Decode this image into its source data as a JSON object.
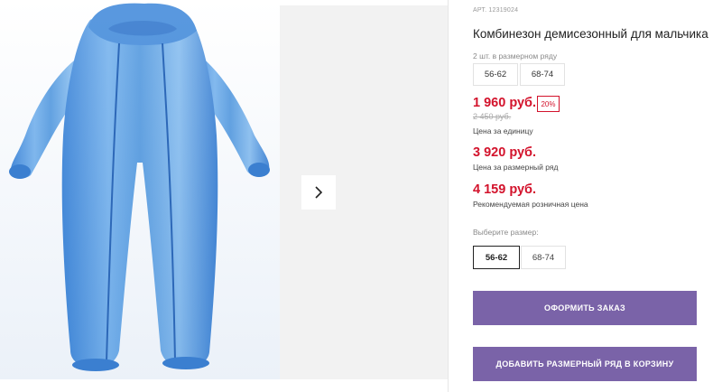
{
  "product": {
    "article": "АРТ. 12319024",
    "title": "Комбинезон демисезонный для мальчика",
    "pack_count": "2 шт. в размерном ряду",
    "pack_sizes": [
      "56-62",
      "68-74"
    ]
  },
  "prices": {
    "unit_price": "1 960 руб.",
    "discount": "20%",
    "old_price": "2 450 руб.",
    "unit_label": "Цена за единицу",
    "row_price": "3 920 руб.",
    "row_label": "Цена за размерный ряд",
    "retail_price": "4 159 руб.",
    "retail_label": "Рекомендуемая розничная цена"
  },
  "size_selector": {
    "label": "Выберите размер:",
    "options": [
      "56-62",
      "68-74"
    ],
    "selected": "56-62"
  },
  "buttons": {
    "order": "ОФОРМИТЬ ЗАКАЗ",
    "add_row": "ДОБАВИТЬ РАЗМЕРНЫЙ РЯД В КОРЗИНУ"
  },
  "icons": {
    "next": "chevron-right-icon"
  },
  "colors": {
    "accent": "#7a63a8",
    "price_red": "#d3132c",
    "garment_blue": "#5a9de0"
  }
}
